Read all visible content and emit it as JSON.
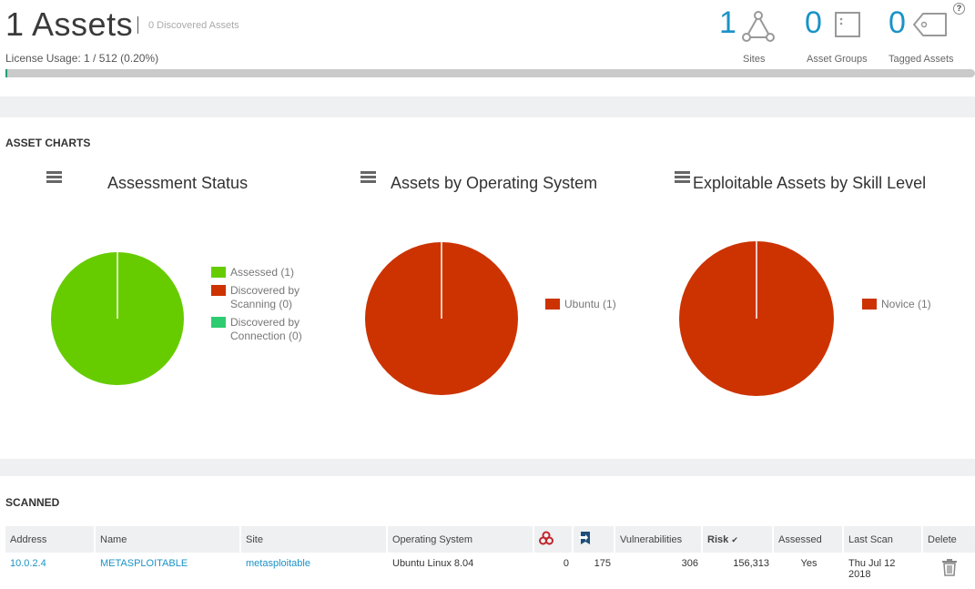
{
  "header": {
    "asset_count_label": "1 Assets",
    "discovered_label": "0 Discovered Assets",
    "license_usage": "License Usage: 1 / 512 (0.20%)",
    "license_fraction": 0.002,
    "stats": [
      {
        "value": "1",
        "label": "Sites",
        "icon": "sites-network-icon"
      },
      {
        "value": "0",
        "label": "Asset Groups",
        "icon": "asset-group-icon"
      },
      {
        "value": "0",
        "label": "Tagged Assets",
        "icon": "tag-icon"
      }
    ],
    "help_label": "?"
  },
  "asset_charts": {
    "section_title": "ASSET CHARTS",
    "charts": [
      {
        "title": "Assessment Status",
        "legend": [
          {
            "label": "Assessed (1)",
            "color": "#66cc00",
            "value": 1
          },
          {
            "label": "Discovered by Scanning (0)",
            "color": "#cc3300",
            "value": 0
          },
          {
            "label": "Discovered by Connection (0)",
            "color": "#2ecc71",
            "value": 0
          }
        ]
      },
      {
        "title": "Assets by Operating System",
        "legend": [
          {
            "label": "Ubuntu (1)",
            "color": "#cc3300",
            "value": 1
          }
        ]
      },
      {
        "title": "Exploitable Assets by Skill Level",
        "legend": [
          {
            "label": "Novice (1)",
            "color": "#cc3300",
            "value": 1
          }
        ]
      }
    ]
  },
  "scanned": {
    "section_title": "SCANNED",
    "columns": [
      "Address",
      "Name",
      "Site",
      "Operating System",
      "",
      "",
      "Vulnerabilities",
      "Risk",
      "Assessed",
      "Last Scan",
      "Delete"
    ],
    "column_icons": {
      "4": "malware-biohazard-icon",
      "5": "exploit-icon"
    },
    "rows": [
      {
        "address": "10.0.2.4",
        "name": "METASPLOITABLE",
        "site": "metasploitable",
        "os": "Ubuntu Linux 8.04",
        "malware": "0",
        "exploits": "175",
        "vulnerabilities": "306",
        "risk": "156,313",
        "assessed": "Yes",
        "last_scan": "Thu Jul 12 2018"
      }
    ]
  }
}
